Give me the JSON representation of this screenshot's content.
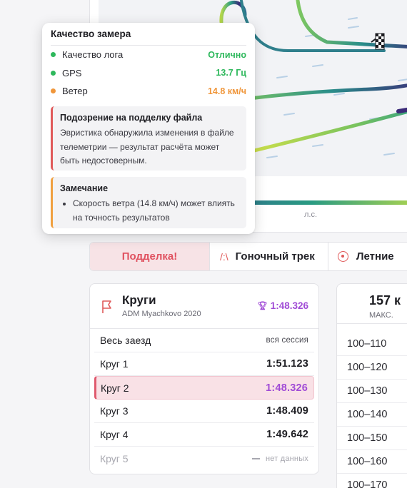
{
  "map": {
    "legend_label": "л.с.",
    "finish_icon": "checkered-flag-icon"
  },
  "quality_popover": {
    "title": "Качество замера",
    "metrics": [
      {
        "label": "Качество лога",
        "value": "Отлично",
        "color": "#2eb85c"
      },
      {
        "label": "GPS",
        "value": "13.7 Гц",
        "color": "#2eb85c"
      },
      {
        "label": "Ветер",
        "value": "14.8 км/ч",
        "color": "#f0963a"
      }
    ],
    "fake_alert": {
      "title": "Подозрение на подделку файла",
      "text": "Эвристика обнаружила изменения в файле телеметрии — результат расчёта может быть недостоверным.",
      "color": "#e05a5a"
    },
    "note_alert": {
      "title": "Замечание",
      "items": [
        "Скорость ветра (14.8 км/ч) может влиять на точность результатов"
      ],
      "color": "#f0a040"
    }
  },
  "tags": {
    "fake": "Подделка!",
    "track": "Гоночный трек",
    "tires": "Летние"
  },
  "laps": {
    "title": "Круги",
    "subtitle": "ADM Myachkovo 2020",
    "best_time": "1:48.326",
    "best_color": "#a04bd6",
    "session": {
      "label": "Весь заезд",
      "value": "вся сессия"
    },
    "rows": [
      {
        "label": "Круг 1",
        "time": "1:51.123"
      },
      {
        "label": "Круг 2",
        "time": "1:48.326",
        "best": true
      },
      {
        "label": "Круг 3",
        "time": "1:48.409"
      },
      {
        "label": "Круг 4",
        "time": "1:49.642"
      }
    ],
    "empty_row": {
      "label": "Круг 5",
      "value": "нет данных"
    }
  },
  "speed": {
    "max_value": "157 к",
    "max_label": "МАКС.",
    "ranges": [
      "100–110",
      "100–120",
      "100–130",
      "100–140",
      "100–150",
      "100–160",
      "100–170"
    ]
  }
}
